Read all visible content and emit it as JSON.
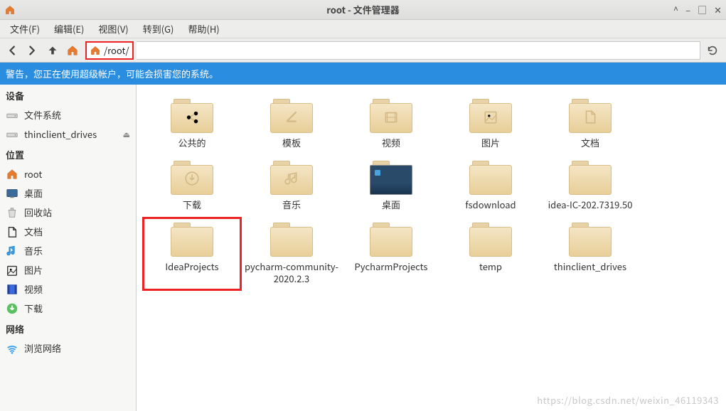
{
  "window": {
    "title": "root - 文件管理器"
  },
  "menubar": {
    "file": "文件(F)",
    "edit": "编辑(E)",
    "view": "视图(V)",
    "go": "转到(G)",
    "help": "帮助(H)"
  },
  "path": "/root/",
  "warning": "警告，您正在使用超级帐户，可能会损害您的系统。",
  "sidebar": {
    "devices_heading": "设备",
    "devices": [
      {
        "label": "文件系统",
        "icon": "drive"
      },
      {
        "label": "thinclient_drives",
        "icon": "drive",
        "eject": true
      }
    ],
    "places_heading": "位置",
    "places": [
      {
        "label": "root",
        "icon": "home"
      },
      {
        "label": "桌面",
        "icon": "desktop"
      },
      {
        "label": "回收站",
        "icon": "trash"
      },
      {
        "label": "文档",
        "icon": "doc"
      },
      {
        "label": "音乐",
        "icon": "music"
      },
      {
        "label": "图片",
        "icon": "pic"
      },
      {
        "label": "视频",
        "icon": "video"
      },
      {
        "label": "下载",
        "icon": "download"
      }
    ],
    "network_heading": "网络",
    "network": [
      {
        "label": "浏览网络",
        "icon": "wifi"
      }
    ]
  },
  "folders": [
    {
      "label": "公共的",
      "glyph": "share"
    },
    {
      "label": "模板",
      "glyph": "template"
    },
    {
      "label": "视频",
      "glyph": "video"
    },
    {
      "label": "图片",
      "glyph": "pic"
    },
    {
      "label": "文档",
      "glyph": "doc"
    },
    {
      "label": "下载",
      "glyph": "download"
    },
    {
      "label": "音乐",
      "glyph": "music"
    },
    {
      "label": "桌面",
      "glyph": "desktop",
      "thumb": true
    },
    {
      "label": "fsdownload",
      "glyph": ""
    },
    {
      "label": "idea-IC-202.7319.50",
      "glyph": ""
    },
    {
      "label": "IdeaProjects",
      "glyph": "",
      "highlight": true
    },
    {
      "label": "pycharm-community-2020.2.3",
      "glyph": ""
    },
    {
      "label": "PycharmProjects",
      "glyph": ""
    },
    {
      "label": "temp",
      "glyph": ""
    },
    {
      "label": "thinclient_drives",
      "glyph": ""
    }
  ],
  "watermark": "https://blog.csdn.net/weixin_46119343"
}
